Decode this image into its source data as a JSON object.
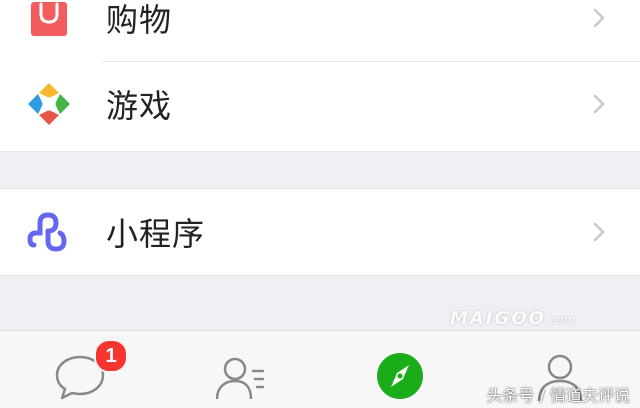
{
  "discover_list": {
    "group1": [
      {
        "label": "购物",
        "icon": "shopping-bag-icon"
      },
      {
        "label": "游戏",
        "icon": "game-diamond-icon"
      }
    ],
    "group2": [
      {
        "label": "小程序",
        "icon": "mini-program-icon"
      }
    ]
  },
  "tabbar": {
    "tabs": [
      {
        "icon": "chat-bubble-icon",
        "badge": "1"
      },
      {
        "icon": "contacts-icon"
      },
      {
        "icon": "compass-icon",
        "active": true
      },
      {
        "icon": "me-person-icon"
      }
    ]
  },
  "watermarks": {
    "logo": "MAIGOO",
    "logo_suffix": ".com",
    "caption": "头条号 / 情道夫评说"
  },
  "colors": {
    "background": "#efeff4",
    "brand_green": "#1aad19",
    "badge_red": "#f43530",
    "shopping_red": "#f25c5c",
    "mini_program_blue": "#6467f0"
  }
}
